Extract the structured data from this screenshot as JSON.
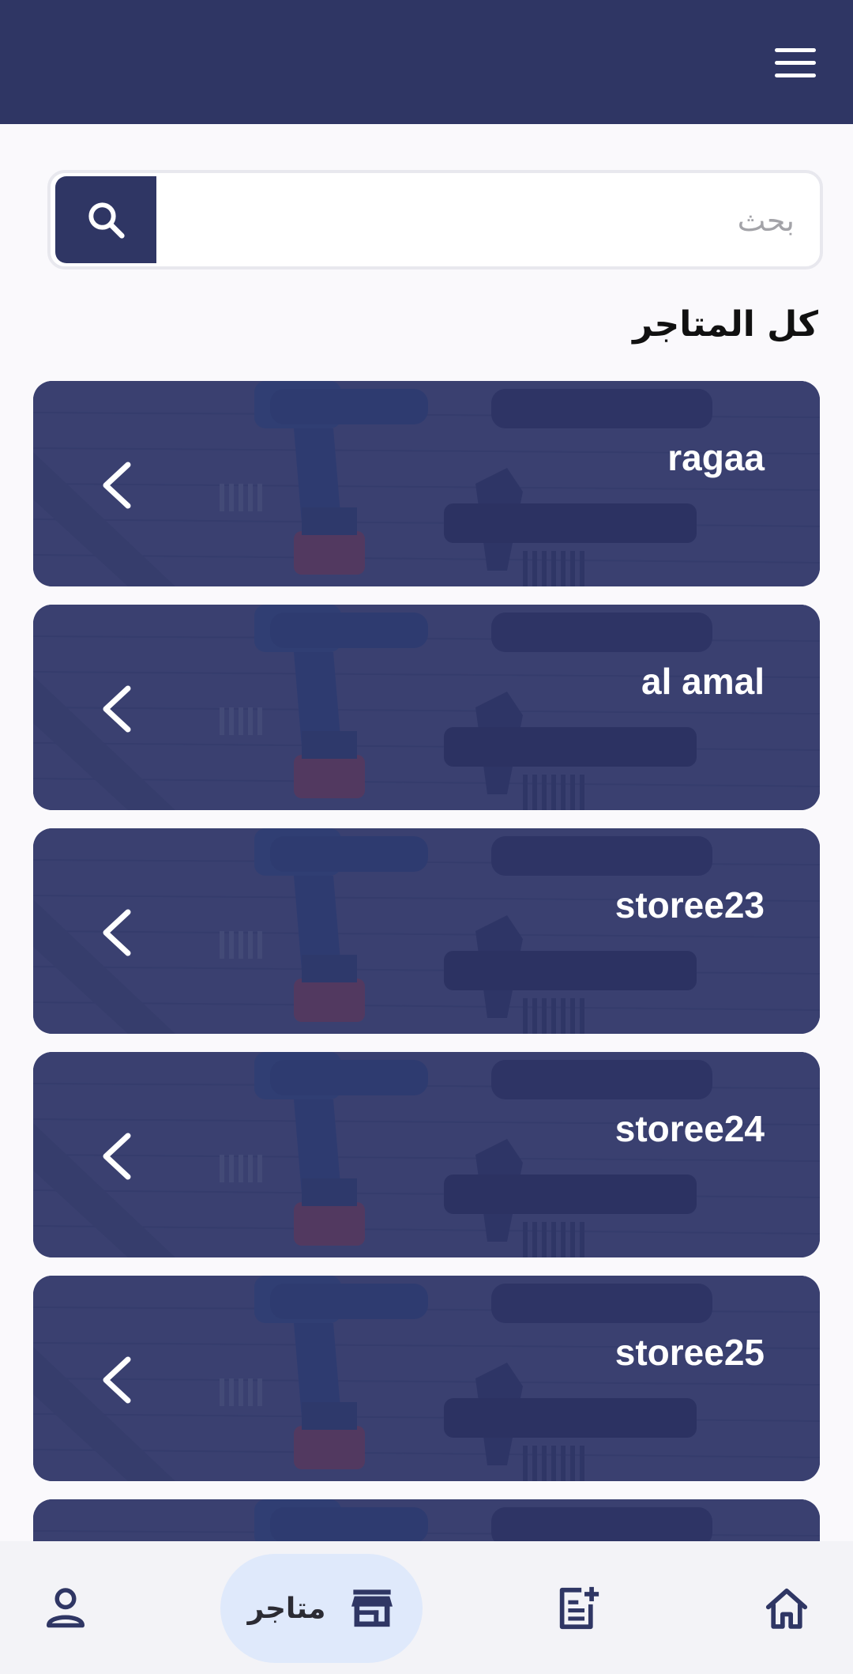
{
  "header": {
    "menu_icon": "menu-icon"
  },
  "search": {
    "placeholder": "بحث",
    "icon": "search-icon"
  },
  "section_title": "كل المتاجر",
  "stores": [
    {
      "name": "ragaa"
    },
    {
      "name": "al amal"
    },
    {
      "name": "storee23"
    },
    {
      "name": "storee24"
    },
    {
      "name": "storee25"
    },
    {
      "name": ""
    }
  ],
  "bottom_nav": {
    "items": [
      {
        "icon": "home-icon"
      },
      {
        "icon": "add-note-icon"
      },
      {
        "icon": "store-icon",
        "label": "متاجر",
        "active": true
      },
      {
        "icon": "person-icon"
      }
    ]
  },
  "colors": {
    "primary": "#2f3664",
    "active_pill": "#dfe9fb",
    "background": "#faf9fc"
  }
}
